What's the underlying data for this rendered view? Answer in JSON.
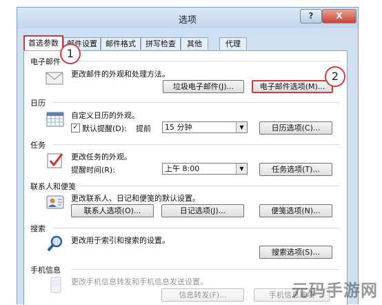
{
  "window": {
    "title": "选项",
    "help": "?",
    "close": "X"
  },
  "tabs": [
    "首选参数",
    "邮件设置",
    "邮件格式",
    "拼写检查",
    "其他",
    "代理"
  ],
  "badges": [
    "1",
    "2"
  ],
  "sections": {
    "email": {
      "title": "电子邮件",
      "desc": "更改邮件的外观和处理方法。",
      "junk_button": "垃圾电子邮件(J)...",
      "options_button": "电子邮件选项(M)..."
    },
    "calendar": {
      "title": "日历",
      "desc": "自定义日历的外观。",
      "reminder_label": "默认提醒(D):",
      "advance_label": "提前",
      "advance_value": "15 分钟",
      "reminder_checked": true,
      "options_button": "日历选项(C)..."
    },
    "tasks": {
      "title": "任务",
      "desc": "更改任务的外观。",
      "time_label": "提醒时间(R):",
      "time_value": "上午 8:00",
      "options_button": "任务选项(T)..."
    },
    "contacts": {
      "title": "联系人和便笺",
      "desc": "更改联系人、日记和便笺的默认设置。",
      "contacts_button": "联系人选项(O)...",
      "journal_button": "日记选项(J)...",
      "notes_button": "便笺选项(N)..."
    },
    "search": {
      "title": "搜索",
      "desc": "更改用于索引和搜索的设置。",
      "options_button": "搜索选项(S)..."
    },
    "mobile": {
      "title": "手机信息",
      "desc": "更改手机信息转发和手机信息发送设置。",
      "forward_button": "信息转发(F)...",
      "options_button": "手机信息选项"
    }
  },
  "watermark": "元码手游网"
}
